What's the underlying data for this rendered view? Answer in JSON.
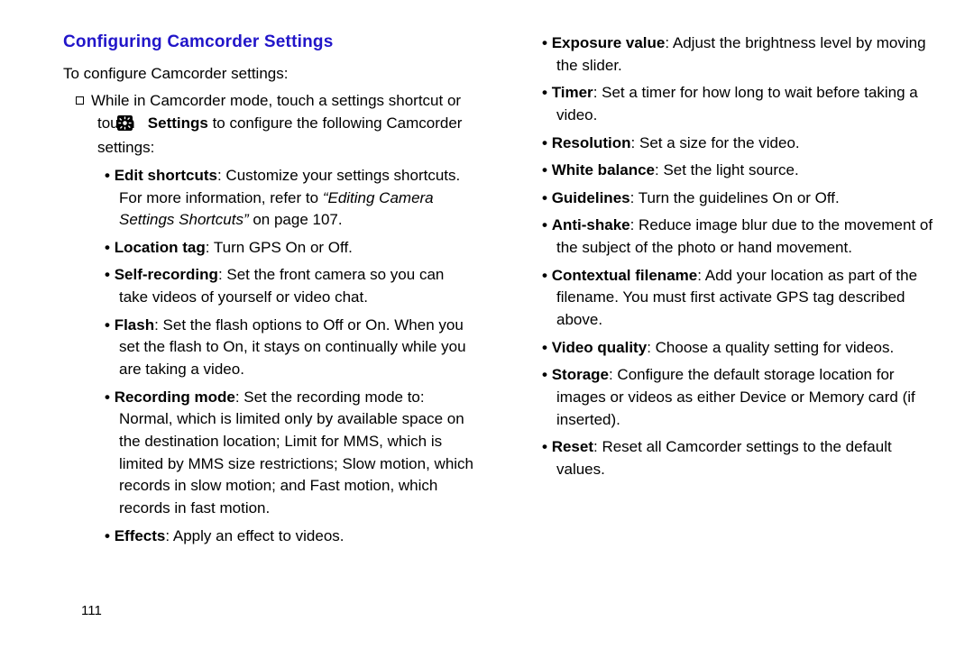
{
  "pageNumber": "111",
  "section": {
    "title": "Configuring Camcorder Settings",
    "intro": "To configure Camcorder settings:",
    "step_prefix": "While in Camcorder mode, touch a settings shortcut or touch ",
    "step_bold": "Settings",
    "step_suffix": " to configure the following Camcorder settings:"
  },
  "left_items": [
    {
      "term": "Edit shortcuts",
      "body_pre": ": Customize your settings shortcuts. For more information, refer to ",
      "body_italic": "“Editing Camera Settings Shortcuts”",
      "body_post": " on page 107."
    },
    {
      "term": "Location tag",
      "body_pre": ": Turn GPS On or Off.",
      "body_italic": "",
      "body_post": ""
    },
    {
      "term": "Self-recording",
      "body_pre": ": Set the front camera so you can take videos of yourself or video chat.",
      "body_italic": "",
      "body_post": ""
    },
    {
      "term": "Flash",
      "body_pre": ": Set the flash options to Off or On. When you set the flash to On, it stays on continually while you are taking a video.",
      "body_italic": "",
      "body_post": ""
    },
    {
      "term": "Recording mode",
      "body_pre": ": Set the recording mode to: Normal, which is limited only by available space on the destination location; Limit for MMS, which is limited by MMS size restrictions; Slow motion, which records in slow motion; and Fast motion, which records in fast motion.",
      "body_italic": "",
      "body_post": ""
    },
    {
      "term": "Effects",
      "body_pre": ": Apply an effect to videos.",
      "body_italic": "",
      "body_post": ""
    }
  ],
  "right_items": [
    {
      "term": "Exposure value",
      "body_pre": ": Adjust the brightness level by moving the slider.",
      "body_italic": "",
      "body_post": ""
    },
    {
      "term": "Timer",
      "body_pre": ": Set a timer for how long to wait before taking a video.",
      "body_italic": "",
      "body_post": ""
    },
    {
      "term": "Resolution",
      "body_pre": ": Set a size for the video.",
      "body_italic": "",
      "body_post": ""
    },
    {
      "term": "White balance",
      "body_pre": ": Set the light source.",
      "body_italic": "",
      "body_post": ""
    },
    {
      "term": "Guidelines",
      "body_pre": ": Turn the guidelines On or Off.",
      "body_italic": "",
      "body_post": ""
    },
    {
      "term": "Anti-shake",
      "body_pre": ": Reduce image blur due to the movement of the subject of the photo or hand movement.",
      "body_italic": "",
      "body_post": ""
    },
    {
      "term": "Contextual filename",
      "body_pre": ": Add your location as part of the filename. You must first activate GPS tag described above.",
      "body_italic": "",
      "body_post": ""
    },
    {
      "term": "Video quality",
      "body_pre": ": Choose a quality setting for videos.",
      "body_italic": "",
      "body_post": ""
    },
    {
      "term": "Storage",
      "body_pre": ": Configure the default storage location for images or videos as either Device or Memory card (if inserted).",
      "body_italic": "",
      "body_post": ""
    },
    {
      "term": "Reset",
      "body_pre": ": Reset all Camcorder settings to the default values.",
      "body_italic": "",
      "body_post": ""
    }
  ]
}
